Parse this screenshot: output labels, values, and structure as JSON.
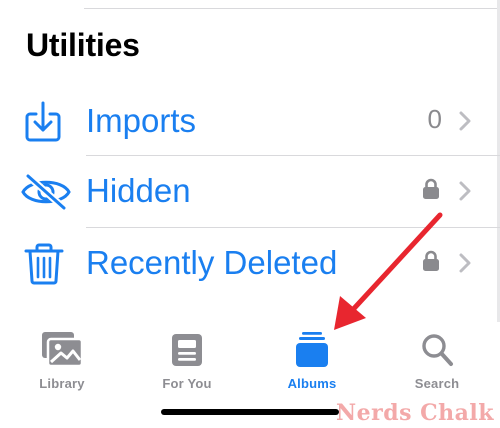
{
  "section": {
    "title": "Utilities"
  },
  "rows": [
    {
      "label": "Imports",
      "meta": "0",
      "icon": "import-icon"
    },
    {
      "label": "Hidden",
      "icon": "eye-slash-icon",
      "locked": true
    },
    {
      "label": "Recently Deleted",
      "icon": "trash-icon",
      "locked": true
    }
  ],
  "tabs": [
    {
      "label": "Library",
      "icon": "photos-icon",
      "active": false
    },
    {
      "label": "For You",
      "icon": "for-you-icon",
      "active": false
    },
    {
      "label": "Albums",
      "icon": "albums-icon",
      "active": true
    },
    {
      "label": "Search",
      "icon": "search-icon",
      "active": false
    }
  ],
  "colors": {
    "accent": "#1a7ff0",
    "inactive": "#8d8d92",
    "annotation_arrow": "#e8262f"
  },
  "watermark": "Nerds Chalk"
}
